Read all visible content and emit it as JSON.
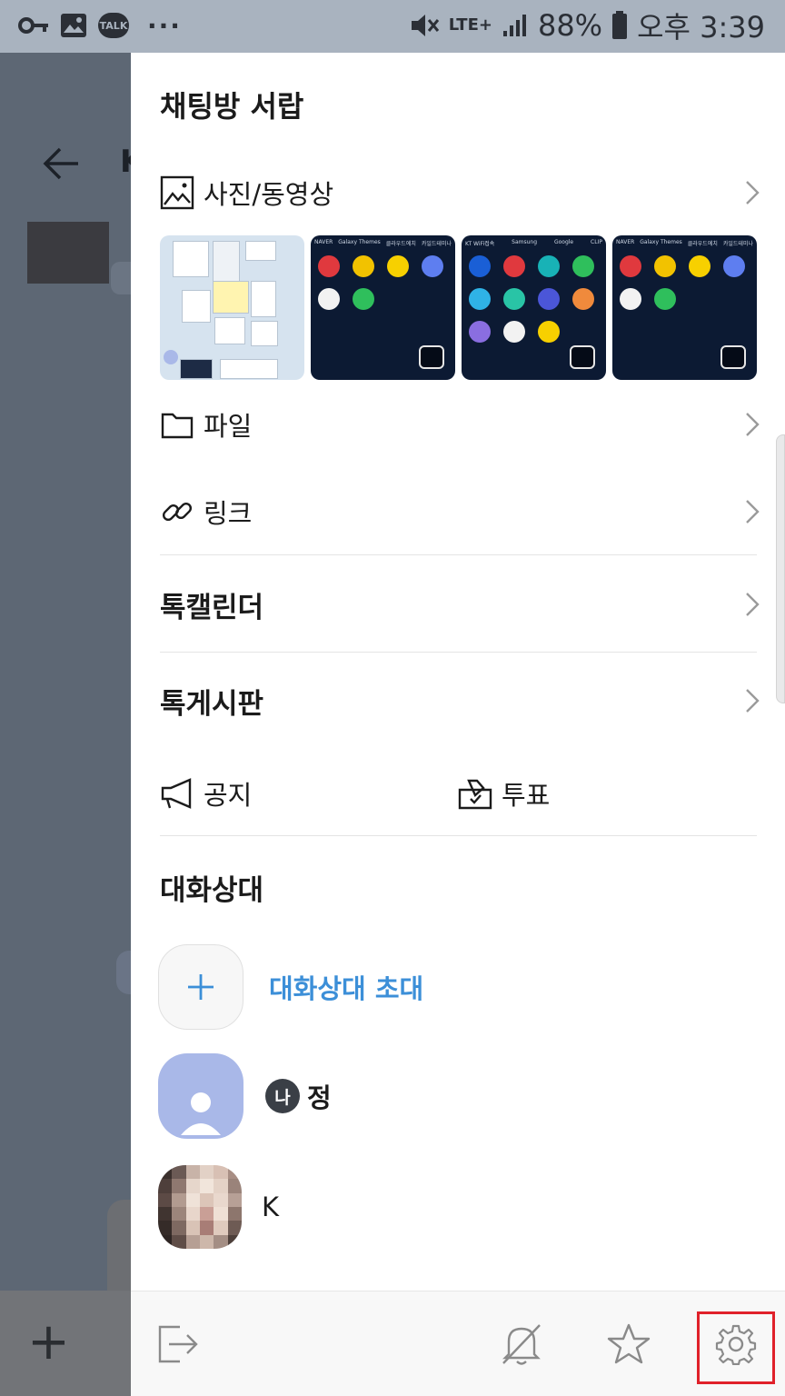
{
  "status_bar": {
    "talk_badge": "TALK",
    "more": "···",
    "network": "LTE+",
    "battery": "88%",
    "time": "오후 3:39"
  },
  "background_chat": {
    "title_initial": "K"
  },
  "drawer": {
    "title": "채팅방 서랍",
    "media": {
      "label": "사진/동영상",
      "icon": "image-icon"
    },
    "thumbnails": [
      {
        "kind": "screenshot-light",
        "labels": []
      },
      {
        "kind": "homescreen",
        "labels": [
          "NAVER",
          "Galaxy Themes",
          "클라우드에치",
          "카일드테미나"
        ]
      },
      {
        "kind": "homescreen",
        "labels": [
          "KT WiFi접속",
          "Samsung",
          "Google",
          "CLIP"
        ]
      },
      {
        "kind": "homescreen",
        "labels": [
          "NAVER",
          "Galaxy Themes",
          "클라우드에치",
          "카일드테미나"
        ]
      }
    ],
    "files": {
      "label": "파일",
      "icon": "folder-icon"
    },
    "links": {
      "label": "링크",
      "icon": "link-icon"
    },
    "calendar": {
      "label": "톡캘린더"
    },
    "board": {
      "label": "톡게시판"
    },
    "notice": {
      "label": "공지",
      "icon": "megaphone-icon"
    },
    "vote": {
      "label": "투표",
      "icon": "vote-box-icon"
    },
    "members_title": "대화상대",
    "invite": {
      "label": "대화상대 초대",
      "icon": "plus-icon"
    },
    "members": [
      {
        "badge": "나",
        "name": "정"
      },
      {
        "name": "K"
      }
    ],
    "footer": {
      "leave_icon": "exit-icon",
      "mute_icon": "bell-off-icon",
      "favorite_icon": "star-icon",
      "settings_icon": "gear-icon"
    }
  },
  "colors": {
    "accent": "#3c8fd8",
    "highlight": "#e0212a",
    "dim_overlay": "#5d6774"
  }
}
